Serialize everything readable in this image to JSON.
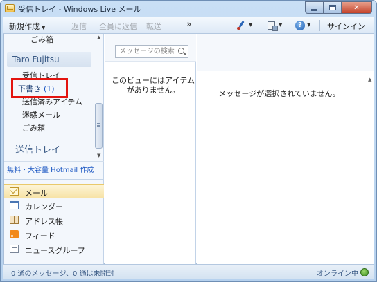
{
  "window": {
    "title": "受信トレイ - Windows Live メール"
  },
  "toolbar": {
    "new_label": "新規作成",
    "reply_label": "返信",
    "reply_all_label": "全員に返信",
    "forward_label": "転送",
    "more_label": "»",
    "signin_label": "サインイン",
    "help_glyph": "?"
  },
  "folders": {
    "top_trash": "ごみ箱",
    "account": "Taro Fujitsu",
    "inbox": "受信トレイ",
    "drafts": "下書き",
    "drafts_count": "(1)",
    "sent": "送信済みアイテム",
    "junk": "迷惑メール",
    "trash": "ごみ箱",
    "outbox": "送信トレイ",
    "promo": "無料・大容量 Hotmail 作成"
  },
  "nav": {
    "mail": "メール",
    "calendar": "カレンダー",
    "contacts": "アドレス帳",
    "feeds": "フィード",
    "newsgroups": "ニュースグループ"
  },
  "list": {
    "search_placeholder": "メッセージの検索",
    "empty_line1": "このビューにはアイテム",
    "empty_line2": "がありません。"
  },
  "reading": {
    "empty_message": "メッセージが選択されていません。"
  },
  "status": {
    "left": "0 通のメッセージ、0 通は未開封",
    "right": "オンライン中"
  },
  "colors": {
    "highlight": "#e3140f",
    "link": "#1a56c2",
    "selected_nav": "#f7e3a6"
  }
}
